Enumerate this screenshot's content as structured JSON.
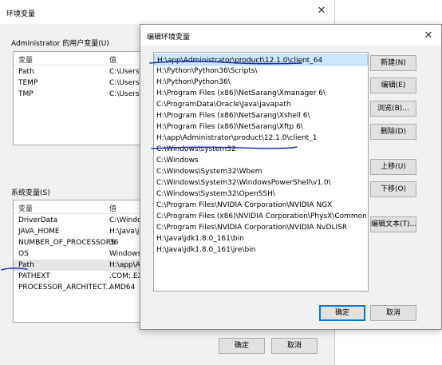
{
  "bg_window": {
    "title": "环境变量",
    "user_section_label": "Administrator 的用户变量(U)",
    "columns": {
      "var": "变量",
      "val": "值"
    },
    "user_vars": [
      {
        "name": "Path",
        "value": "C:\\Users\\A"
      },
      {
        "name": "TEMP",
        "value": "C:\\Users\\A"
      },
      {
        "name": "TMP",
        "value": "C:\\Users\\A"
      }
    ],
    "system_section_label": "系统变量(S)",
    "system_vars": [
      {
        "name": "DriverData",
        "value": "C:\\Window"
      },
      {
        "name": "JAVA_HOME",
        "value": "H:\\Java\\jdk"
      },
      {
        "name": "NUMBER_OF_PROCESSORS",
        "value": "36"
      },
      {
        "name": "OS",
        "value": "Windows_"
      },
      {
        "name": "Path",
        "value": "H:\\app\\Ad"
      },
      {
        "name": "PATHEXT",
        "value": ".COM;.EXE"
      },
      {
        "name": "PROCESSOR_ARCHITECT...",
        "value": "AMD64"
      }
    ],
    "ok_label": "确定",
    "cancel_label": "取消"
  },
  "edit_dialog": {
    "title": "编辑环境变量",
    "paths": [
      "H:\\app\\Administrator\\product\\12.1.0\\client_64",
      "H:\\Python\\Python36\\Scripts\\",
      "H:\\Python\\Python36\\",
      "H:\\Program Files (x86)\\NetSarang\\Xmanager 6\\",
      "C:\\ProgramData\\Oracle\\Java\\javapath",
      "H:\\Program Files (x86)\\NetSarang\\Xshell 6\\",
      "H:\\Program Files (x86)\\NetSarang\\Xftp 6\\",
      "H:\\app\\Administrator\\product\\12.1.0\\client_1",
      "C:\\Windows\\system32",
      "C:\\Windows",
      "C:\\Windows\\System32\\Wbem",
      "C:\\Windows\\System32\\WindowsPowerShell\\v1.0\\",
      "C:\\Windows\\System32\\OpenSSH\\",
      "C:\\Program Files\\NVIDIA Corporation\\NVIDIA NGX",
      "C:\\Program Files (x86)\\NVIDIA Corporation\\PhysX\\Common",
      "C:\\Program Files\\NVIDIA Corporation\\NVIDIA NvDLISR",
      "H:\\Java\\jdk1.8.0_161\\bin",
      "H:\\Java\\jdk1.8.0_161\\jre\\bin"
    ],
    "buttons": {
      "new": "新建(N)",
      "edit": "编辑(E)",
      "browse": "浏览(B)...",
      "delete": "删除(D)",
      "move_up": "上移(U)",
      "move_down": "下移(O)",
      "edit_text": "编辑文本(T)..."
    },
    "ok_label": "确定",
    "cancel_label": "取消"
  },
  "colors": {
    "selection": "#cce8ff",
    "accent": "#0078d7",
    "ink": "#1a2fb5"
  }
}
